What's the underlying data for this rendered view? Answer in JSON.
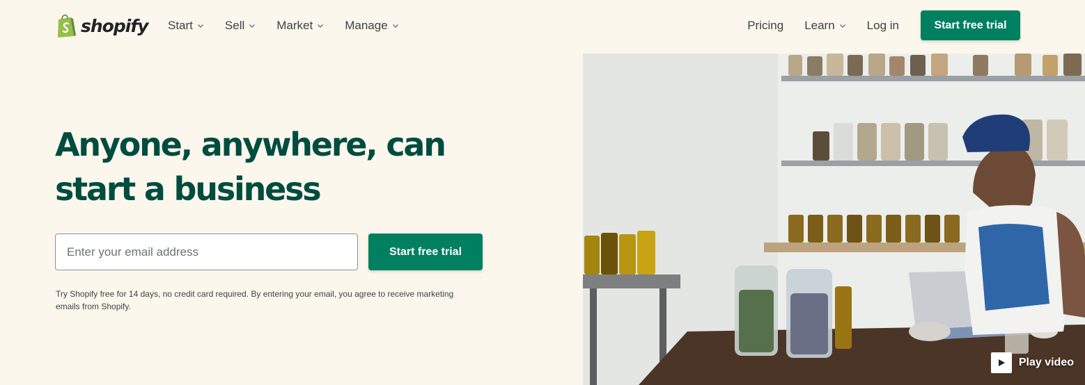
{
  "header": {
    "logo_text": "shopify",
    "nav_left": [
      {
        "label": "Start"
      },
      {
        "label": "Sell"
      },
      {
        "label": "Market"
      },
      {
        "label": "Manage"
      }
    ],
    "nav_right": {
      "pricing": "Pricing",
      "learn": "Learn",
      "login": "Log in",
      "cta": "Start free trial"
    }
  },
  "hero": {
    "title": "Anyone, anywhere, can start a business",
    "email_placeholder": "Enter your email address",
    "email_value": "",
    "cta": "Start free trial",
    "disclaimer": "Try Shopify free for 14 days, no credit card required. By entering your email, you agree to receive marketing emails from Shopify."
  },
  "media": {
    "play_label": "Play video"
  },
  "colors": {
    "brand_green": "#008060",
    "headline_green": "#004c3f",
    "background": "#fbf7ed"
  },
  "icons": {
    "logo": "shopify-bag-icon",
    "dropdown": "chevron-down-icon",
    "play": "play-icon"
  }
}
